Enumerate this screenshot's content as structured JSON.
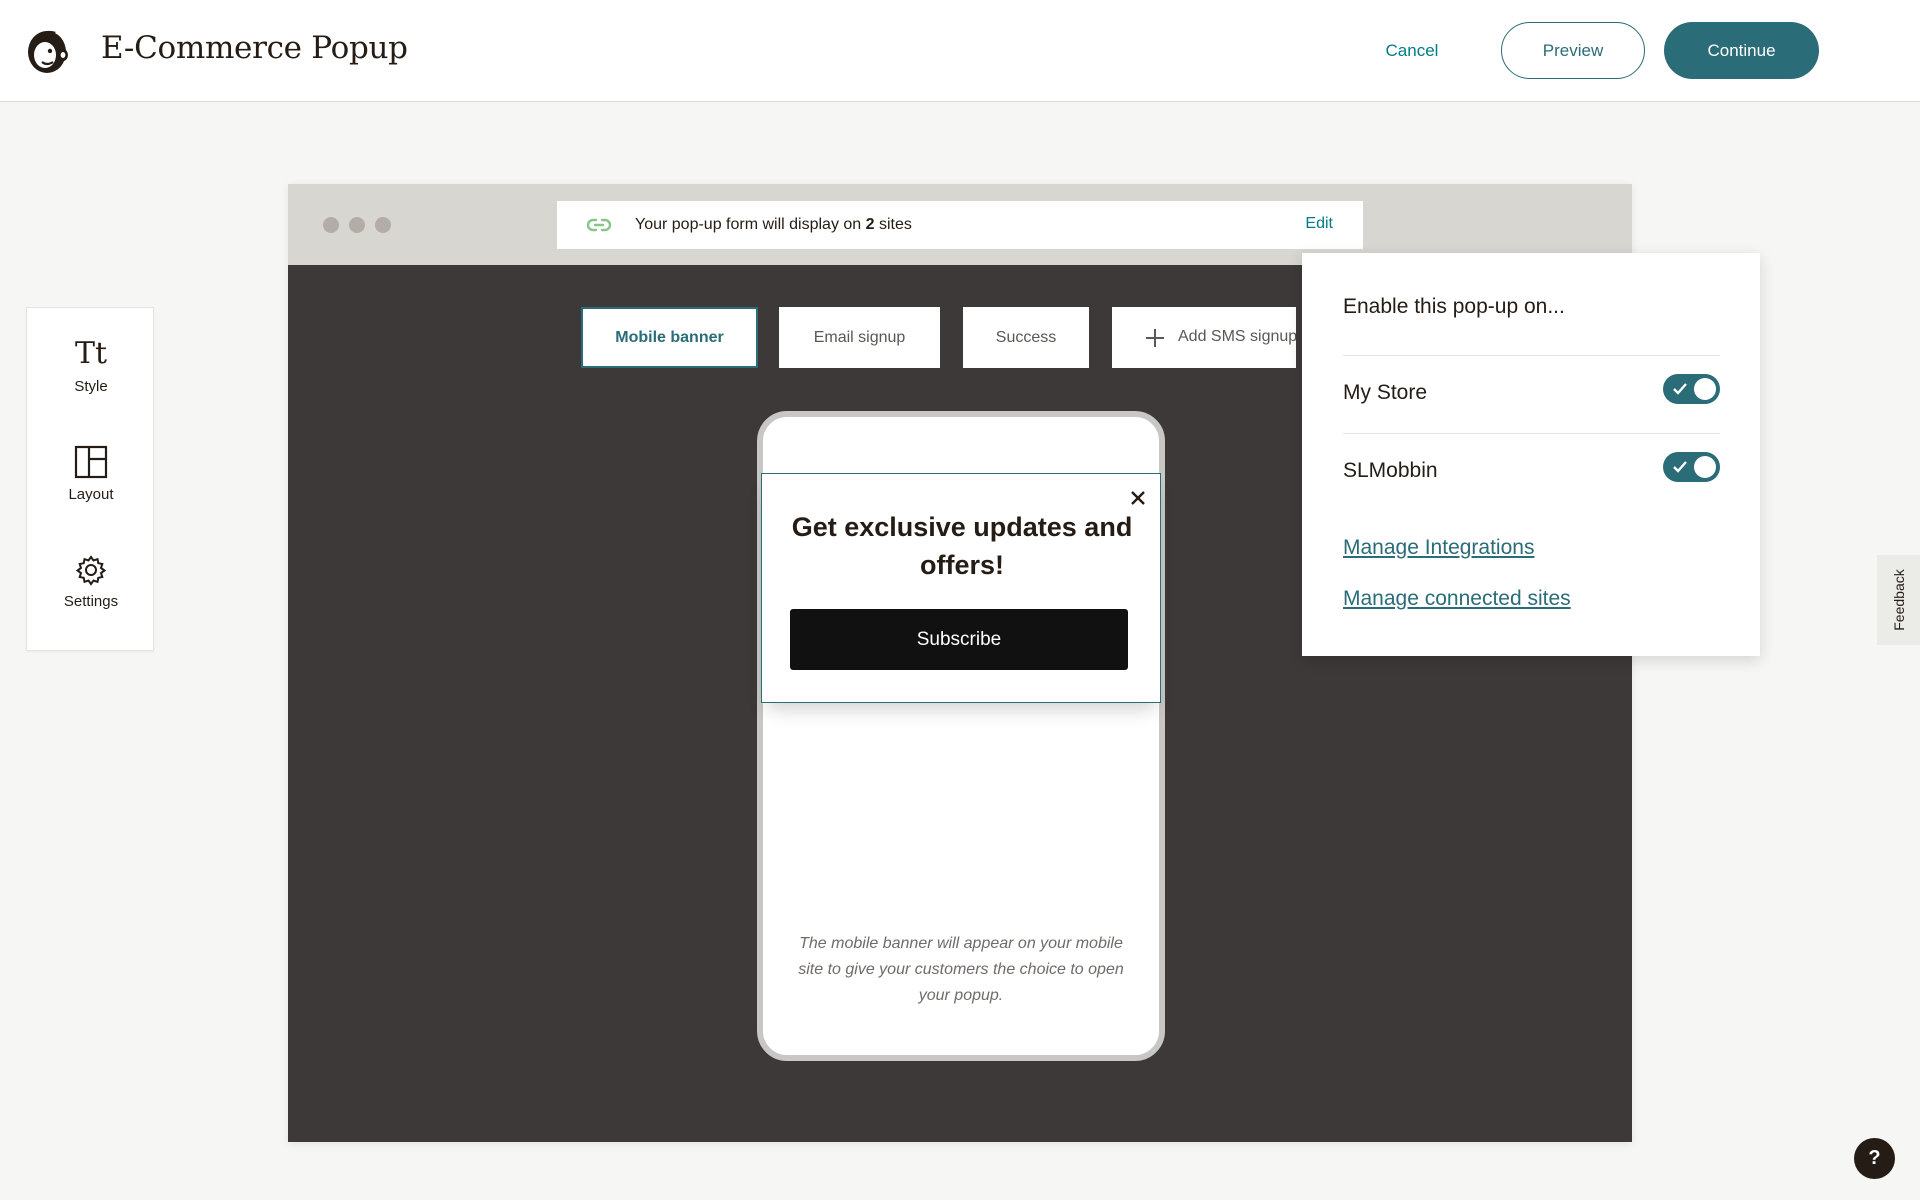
{
  "header": {
    "app_title": "E-Commerce Popup",
    "logo_icon": "mailchimp-freddie-logo",
    "cancel_label": "Cancel",
    "preview_label": "Preview",
    "continue_label": "Continue"
  },
  "tools": [
    {
      "label": "Style",
      "glyph": "Tt",
      "icon": "style-icon"
    },
    {
      "label": "Layout",
      "icon": "layout-icon"
    },
    {
      "label": "Settings",
      "icon": "gear-icon"
    }
  ],
  "browser": {
    "url_text_prefix": "Your pop-up form will display on ",
    "url_site_count": "2",
    "url_text_suffix": " sites",
    "edit_label": "Edit",
    "link_icon": "link-icon"
  },
  "tabs": [
    {
      "label": "Mobile banner",
      "selected": true
    },
    {
      "label": "Email signup",
      "selected": false
    },
    {
      "label": "Success",
      "selected": false
    },
    {
      "label": "Add SMS signup",
      "selected": false
    }
  ],
  "phone": {
    "popup_heading": "Get exclusive updates and offers!",
    "subscribe_label": "Subscribe",
    "close_icon": "close-icon",
    "note": "The mobile banner will appear on your mobile site to give your customers the choice to open your popup."
  },
  "dropdown": {
    "title": "Enable this pop-up on...",
    "sites": [
      {
        "name": "My Store",
        "enabled": true
      },
      {
        "name": "SLMobbin",
        "enabled": true
      }
    ],
    "links": [
      "Manage Integrations",
      "Manage connected sites"
    ]
  },
  "feedback_label": "Feedback",
  "help_label": "?",
  "colors": {
    "accent": "#2a6c77",
    "link": "#007c89",
    "canvas_dark": "#3d3938",
    "page_bg": "#f6f6f4",
    "toggle_on": "#2a6c77"
  }
}
